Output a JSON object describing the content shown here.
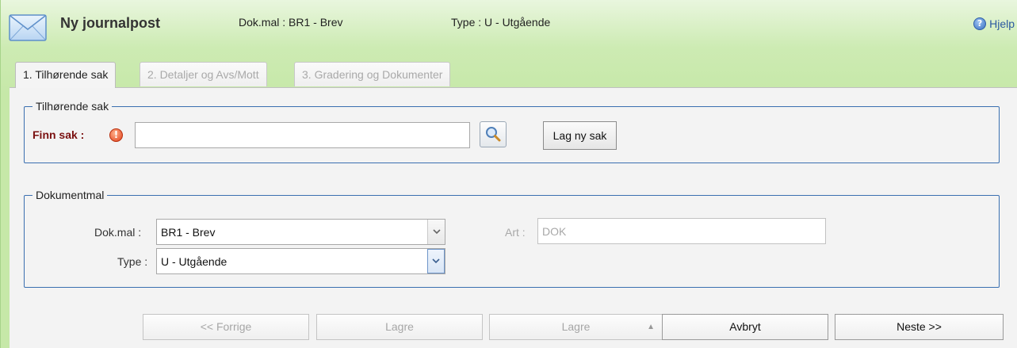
{
  "header": {
    "title": "Ny journalpost",
    "dokmal_info": "Dok.mal : BR1 - Brev",
    "type_info": "Type : U - Utgående",
    "help_label": "Hjelp",
    "help_icon": "help-circle-icon",
    "app_icon": "envelope-icon"
  },
  "tabs": [
    {
      "label": "1. Tilhørende sak",
      "active": true
    },
    {
      "label": "2. Detaljer og Avs/Mott",
      "active": false
    },
    {
      "label": "3. Gradering og Dokumenter",
      "active": false
    }
  ],
  "tilhorende_sak": {
    "legend": "Tilhørende sak",
    "finn_sak_label": "Finn sak :",
    "finn_sak_value": "",
    "search_icon": "magnifier-icon",
    "required_icon": "exclamation-icon",
    "lag_ny_sak_label": "Lag ny sak"
  },
  "dokumentmal": {
    "legend": "Dokumentmal",
    "dokmal_label": "Dok.mal :",
    "dokmal_value": "BR1 - Brev",
    "type_label": "Type :",
    "type_value": "U - Utgående",
    "art_label": "Art :",
    "art_value": "DOK"
  },
  "footer": {
    "forrige_label": "<< Forrige",
    "lagre_label": "Lagre",
    "lagre_dropdown_label": "Lagre",
    "avbryt_label": "Avbryt",
    "neste_label": "Neste >>"
  },
  "colors": {
    "header_green": "#c6e8a8",
    "panel_bg": "#f3f3f3",
    "fieldset_border": "#3a6fb0",
    "required_label": "#7a1010",
    "help_link": "#2c5aa0"
  }
}
